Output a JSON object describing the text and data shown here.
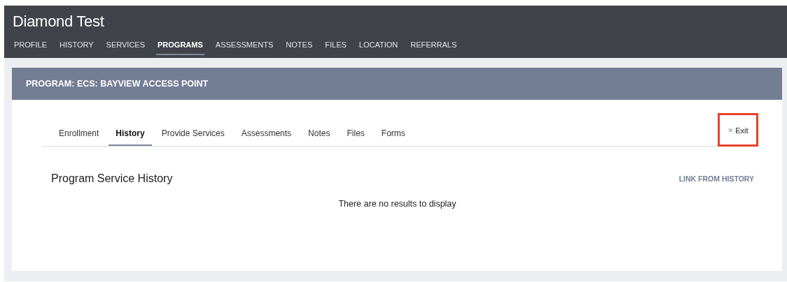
{
  "header": {
    "title": "Diamond Test"
  },
  "nav": [
    {
      "label": "PROFILE",
      "selected": false
    },
    {
      "label": "HISTORY",
      "selected": false
    },
    {
      "label": "SERVICES",
      "selected": false
    },
    {
      "label": "PROGRAMS",
      "selected": true
    },
    {
      "label": "ASSESSMENTS",
      "selected": false
    },
    {
      "label": "NOTES",
      "selected": false
    },
    {
      "label": "FILES",
      "selected": false
    },
    {
      "label": "LOCATION",
      "selected": false
    },
    {
      "label": "REFERRALS",
      "selected": false
    }
  ],
  "program": {
    "title": "PROGRAM: ECS: BAYVIEW ACCESS POINT"
  },
  "tabs": [
    {
      "label": "Enrollment",
      "selected": false
    },
    {
      "label": "History",
      "selected": true
    },
    {
      "label": "Provide Services",
      "selected": false
    },
    {
      "label": "Assessments",
      "selected": false
    },
    {
      "label": "Notes",
      "selected": false
    },
    {
      "label": "Files",
      "selected": false
    },
    {
      "label": "Forms",
      "selected": false
    }
  ],
  "exit": {
    "icon": "×",
    "label": "Exit",
    "highlighted": true
  },
  "section": {
    "title": "Program Service History",
    "link": "LINK FROM HISTORY",
    "empty_message": "There are no results to display"
  }
}
